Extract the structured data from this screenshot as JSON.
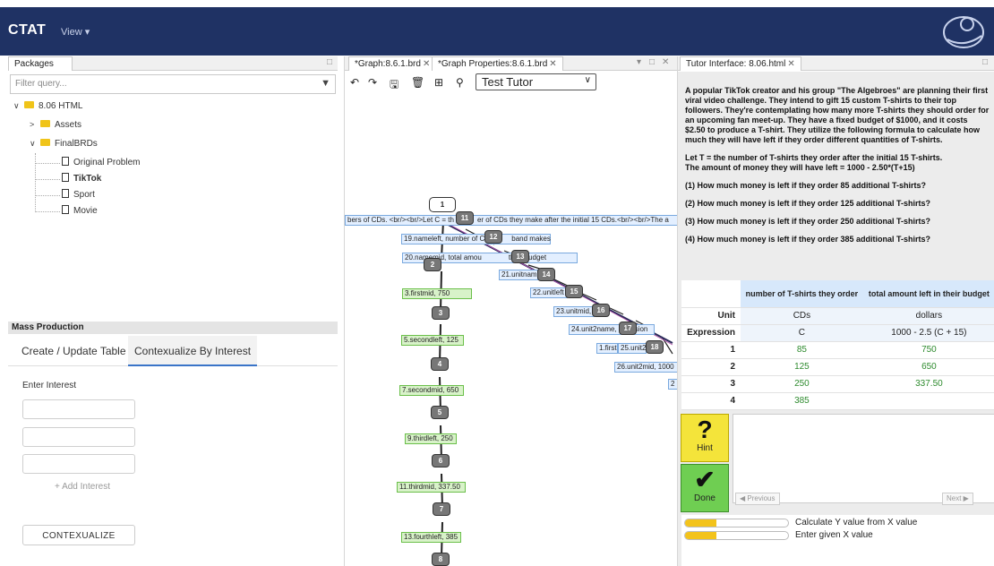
{
  "topbar": {
    "brand": "CTAT",
    "view_menu": "View ▾"
  },
  "packages": {
    "tab_label": "Packages",
    "filter_placeholder": "Filter query...",
    "tree": {
      "root": "8.06 HTML",
      "assets": "Assets",
      "finalbrds": "FinalBRDs",
      "items": [
        "Original Problem",
        "TikTok",
        "Sport",
        "Movie"
      ]
    }
  },
  "mass_production": {
    "header": "Mass Production",
    "tabs": [
      "Create / Update Table",
      "Contexualize By Interest"
    ],
    "enter_interest_label": "Enter Interest",
    "add_interest": "+ Add Interest",
    "contexualize_button": "CONTEXUALIZE"
  },
  "editor": {
    "tabs": [
      "*Graph:8.6.1.brd",
      "*Graph Properties:8.6.1.brd"
    ],
    "tutor_select": "Test Tutor",
    "graph": {
      "nodes": [
        "1",
        "11",
        "12",
        "13",
        "14",
        "15",
        "16",
        "17",
        "18",
        "2",
        "3",
        "4",
        "5",
        "6",
        "7",
        "8"
      ],
      "labels": {
        "l11": "bers of CDs. <br/><br/>Let C = th",
        "l11b": "er of CDs they make after the initial 15 CDs.<br/><br/>The a",
        "l19": "19.nameleft, number of C",
        "l19b": "band makes",
        "l20": "20.namemid, total amou",
        "l20b": "their budget",
        "l21": "21.unitnam",
        "l22": "22.unitleft",
        "l23": "23.unitmid,",
        "l24": "24.unit2name,",
        "l24b": "sion",
        "l1": "1.first",
        "l25": "25.unit2le",
        "l26": "26.unit2mid, 1000",
        "l27": "2",
        "g3": "3.firstmid, 750",
        "g5": "5.secondleft, 125",
        "g7": "7.secondmid, 650",
        "g9": "9.thirdleft, 250",
        "g11": "11.thirdmid, 337.50",
        "g13": "13.fourthleft, 385"
      }
    }
  },
  "tutor": {
    "tab_label": "Tutor Interface: 8.06.html",
    "problem": [
      "A popular TikTok creator and his group \"The Algebroes\" are planning their first viral video challenge. They intend to gift 15 custom T-shirts to their top followers. They're contemplating how many more T-shirts they should order for an upcoming fan meet-up. They have a fixed budget of $1000, and it costs $2.50 to produce a T-shirt. They utilize the following formula to calculate how much they will have left if they order different quantities of T-shirts.",
      "Let T = the number of T-shirts they order after the initial 15 T-shirts.\nThe amount of money they will have left = 1000 - 2.50*(T+15)",
      "(1) How much money is left if they order 85 additional T-shirts?",
      "(2) How much money is left if they order 125 additional T-shirts?",
      "(3) How much money is left if they order 250 additional T-shirts?",
      "(4) How much money is left if they order 385 additional T-shirts?"
    ],
    "table": {
      "col_headers": [
        "number of T-shirts they order",
        "total amount left in their budget"
      ],
      "unit_label": "Unit",
      "units": [
        "CDs",
        "dollars"
      ],
      "expression_label": "Expression",
      "expressions": [
        "C",
        "1000 - 2.5 (C + 15)"
      ],
      "rows": [
        {
          "label": "1",
          "x": "85",
          "y": "750"
        },
        {
          "label": "2",
          "x": "125",
          "y": "650"
        },
        {
          "label": "3",
          "x": "250",
          "y": "337.50"
        },
        {
          "label": "4",
          "x": "385",
          "y": ""
        }
      ]
    },
    "hint_label": "Hint",
    "done_label": "Done",
    "previous": "◀ Previous",
    "next": "Next ▶",
    "skills": [
      {
        "name": "Calculate Y value from X value",
        "level": 0.3
      },
      {
        "name": "Enter given X value",
        "level": 0.3
      }
    ]
  }
}
